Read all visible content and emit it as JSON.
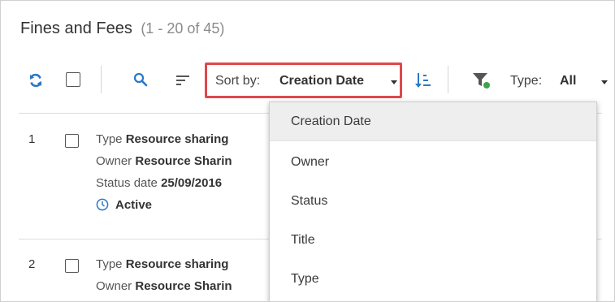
{
  "header": {
    "title": "Fines and Fees",
    "count": "(1 - 20 of 45)"
  },
  "toolbar": {
    "sort_label": "Sort by:",
    "sort_value": "Creation Date",
    "type_label": "Type:",
    "type_value": "All",
    "accent_color": "#2a78c6",
    "highlight_color": "#e0474c"
  },
  "rows": [
    {
      "number": "1",
      "type_label": "Type",
      "type_value": "Resource sharing",
      "owner_label": "Owner",
      "owner_value": "Resource Sharin",
      "status_date_label": "Status date",
      "status_date_value": "25/09/2016",
      "status": "Active"
    },
    {
      "number": "2",
      "type_label": "Type",
      "type_value": "Resource sharing",
      "owner_label": "Owner",
      "owner_value": "Resource Sharin"
    }
  ],
  "sort_menu": {
    "items": [
      "Creation Date",
      "Owner",
      "Status",
      "Title",
      "Type"
    ],
    "selected": "Creation Date"
  }
}
